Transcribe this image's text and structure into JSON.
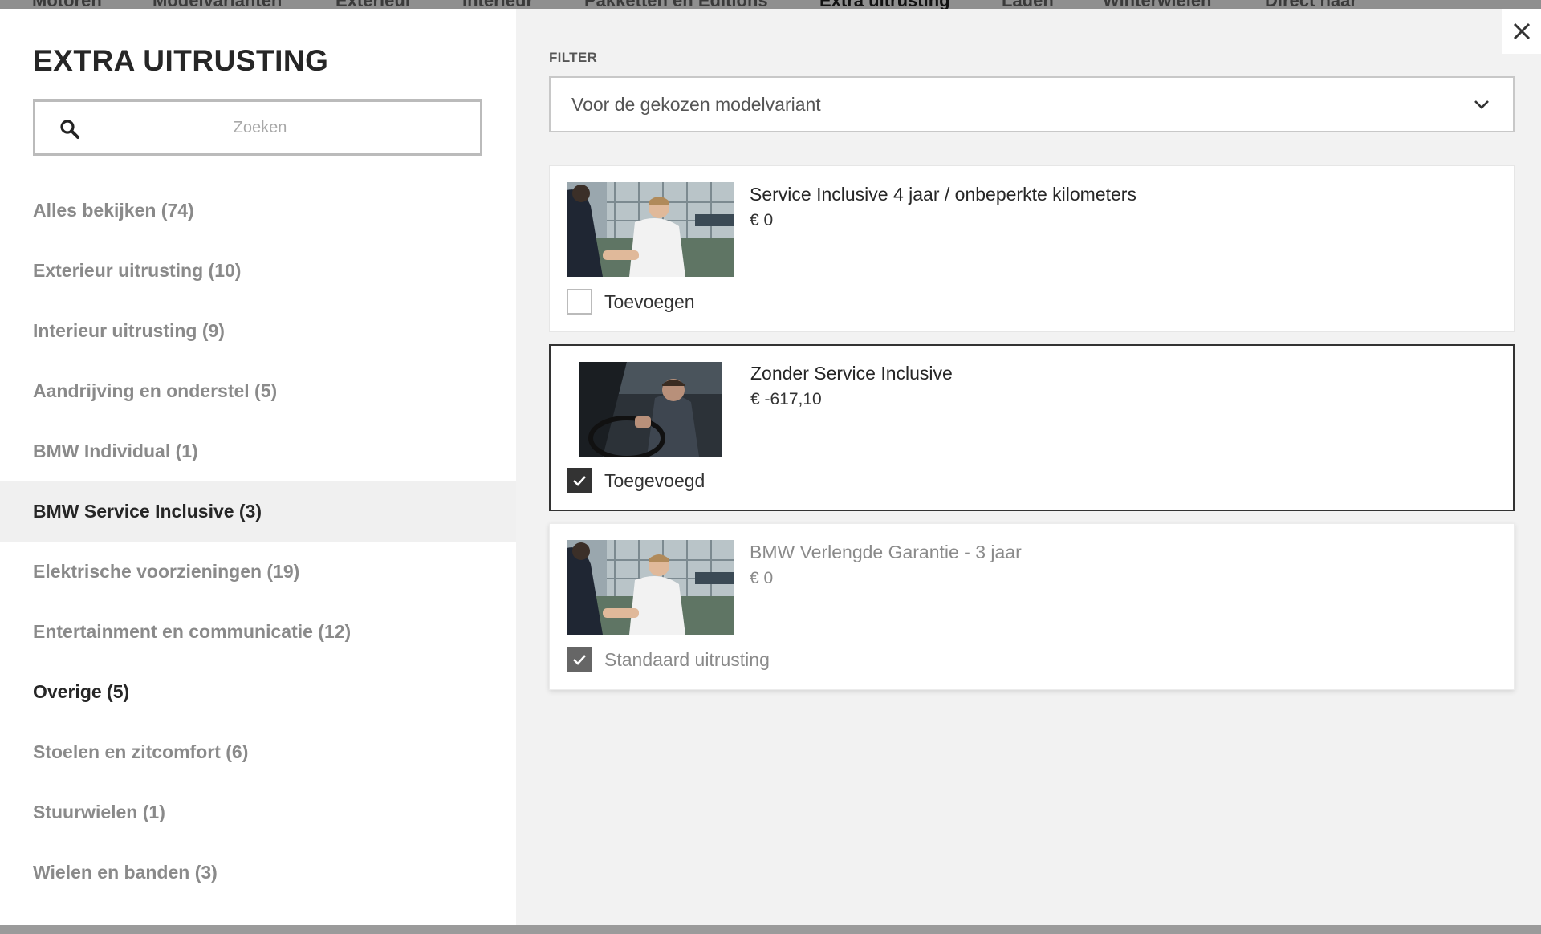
{
  "topnav": {
    "tabs": [
      {
        "label": "Motoren"
      },
      {
        "label": "Modelvarianten"
      },
      {
        "label": "Exterieur"
      },
      {
        "label": "Interieur"
      },
      {
        "label": "Pakketten en Editions"
      },
      {
        "label": "Extra uitrusting"
      },
      {
        "label": "Laden"
      },
      {
        "label": "Winterwielen"
      },
      {
        "label": "Direct naar"
      }
    ]
  },
  "sidebar": {
    "title": "EXTRA UITRUSTING",
    "search": {
      "placeholder": "Zoeken",
      "value": "",
      "icon": "search-icon"
    },
    "categories": [
      {
        "label": "Alles bekijken (74)"
      },
      {
        "label": "Exterieur uitrusting (10)"
      },
      {
        "label": "Interieur uitrusting (9)"
      },
      {
        "label": "Aandrijving en onderstel (5)"
      },
      {
        "label": "BMW Individual (1)"
      },
      {
        "label": "BMW Service Inclusive (3)"
      },
      {
        "label": "Elektrische voorzieningen (19)"
      },
      {
        "label": "Entertainment en communicatie (12)"
      },
      {
        "label": "Overige (5)"
      },
      {
        "label": "Stoelen en zitcomfort (6)"
      },
      {
        "label": "Stuurwielen (1)"
      },
      {
        "label": "Wielen en banden (3)"
      }
    ]
  },
  "main": {
    "filter_label": "FILTER",
    "filter_value": "Voor de gekozen modelvariant",
    "cards": [
      {
        "title": "Service Inclusive 4 jaar / onbeperkte kilometers",
        "price": "€ 0",
        "check_label": "Toevoegen"
      },
      {
        "title": "Zonder Service Inclusive",
        "price": "€ -617,10",
        "check_label": "Toegevoegd"
      },
      {
        "title": "BMW Verlengde Garantie - 3 jaar",
        "price": "€ 0",
        "check_label": "Standaard uitrusting"
      }
    ]
  },
  "colors": {
    "accent": "#262626",
    "muted_text": "#8a8a8a",
    "panel_bg": "#f2f2f2"
  }
}
